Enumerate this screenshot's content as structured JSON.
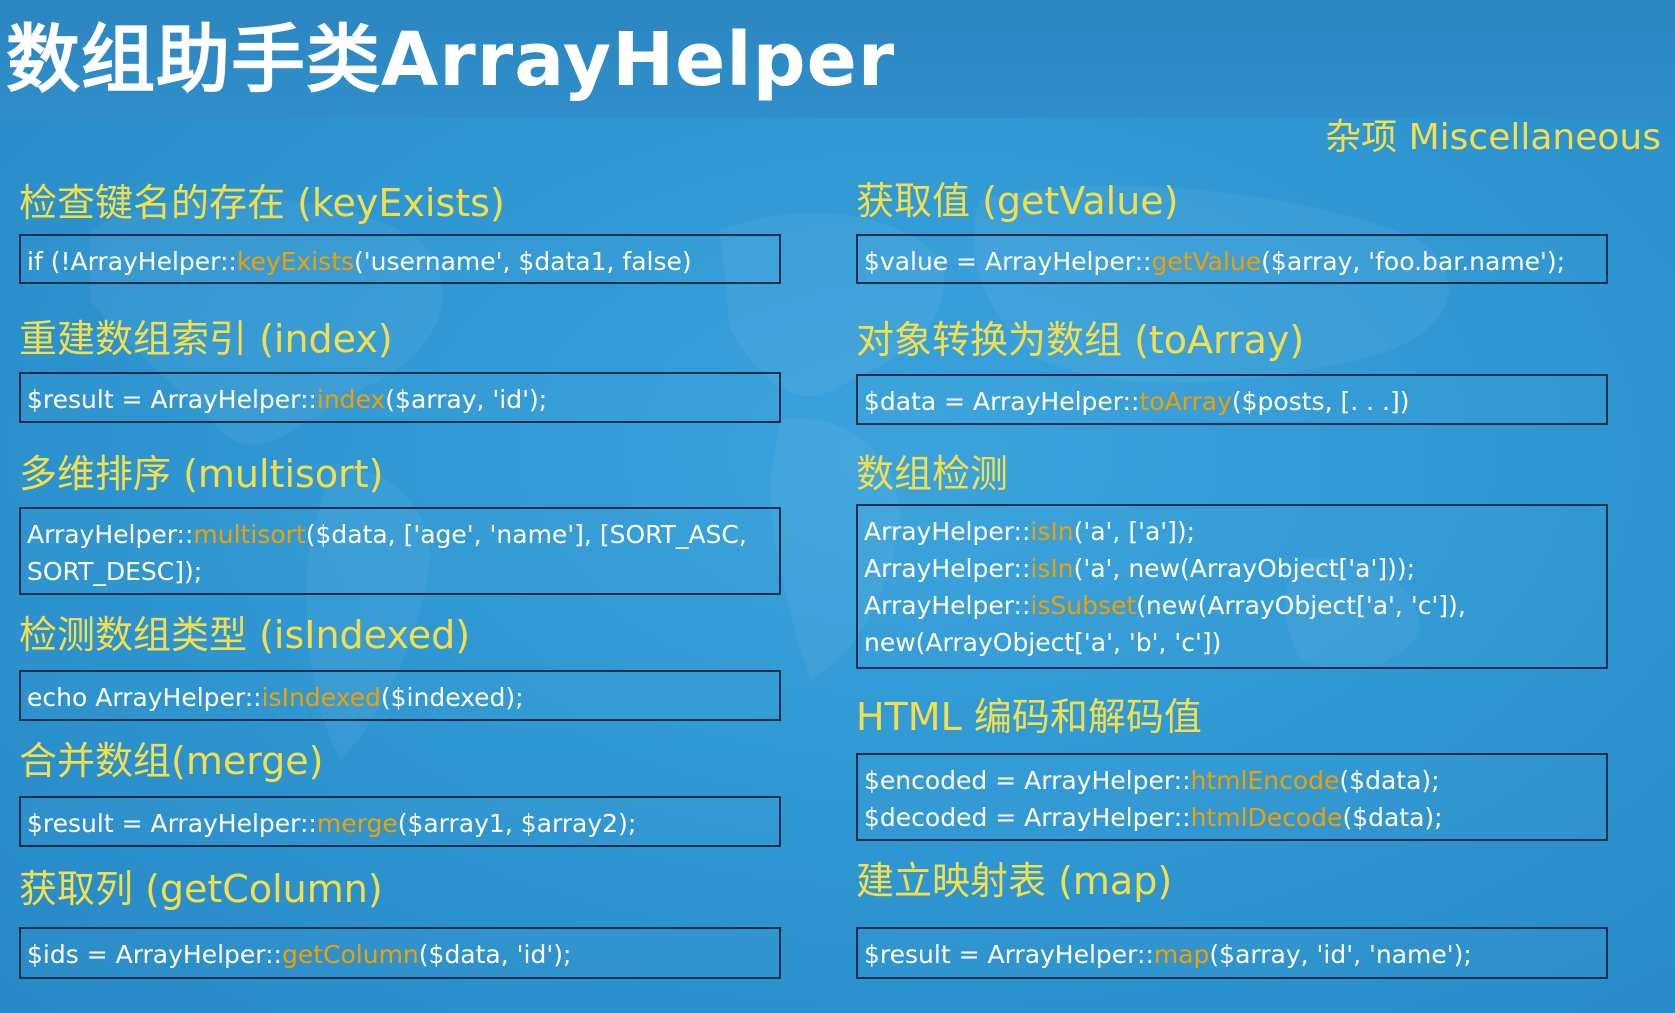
{
  "title": "数组助手类ArrayHelper",
  "subtitle": "杂项 Miscellaneous",
  "colors": {
    "heading": "#f3df4c",
    "method": "#f0a000",
    "code_text": "#ffffff",
    "background": "#2f98d3",
    "box_border": "#0e2f52"
  },
  "left": [
    {
      "heading": "检查键名的存在 (keyExists)",
      "lines": [
        {
          "before": "if (!ArrayHelper::",
          "method": "keyExists",
          "after": "('username', $data1, false)"
        }
      ]
    },
    {
      "heading": "重建数组索引 (index)",
      "lines": [
        {
          "before": "$result = ArrayHelper::",
          "method": "index",
          "after": "($array, 'id');"
        }
      ]
    },
    {
      "heading": "多维排序 (multisort)",
      "lines": [
        {
          "before": "ArrayHelper::",
          "method": "multisort",
          "after": "($data, ['age', 'name'], [SORT_ASC,"
        },
        {
          "before": "SORT_DESC]);",
          "method": "",
          "after": ""
        }
      ]
    },
    {
      "heading": "检测数组类型 (isIndexed)",
      "lines": [
        {
          "before": "echo ArrayHelper::",
          "method": "isIndexed",
          "after": "($indexed);"
        }
      ]
    },
    {
      "heading": "合并数组(merge)",
      "lines": [
        {
          "before": "$result = ArrayHelper::",
          "method": "merge",
          "after": "($array1, $array2);"
        }
      ]
    },
    {
      "heading": "获取列 (getColumn)",
      "lines": [
        {
          "before": "$ids = ArrayHelper::",
          "method": "getColumn",
          "after": "($data, 'id');"
        }
      ]
    }
  ],
  "right": [
    {
      "heading": "获取值 (getValue)",
      "lines": [
        {
          "before": "$value = ArrayHelper::",
          "method": "getValue",
          "after": "($array, 'foo.bar.name');"
        }
      ]
    },
    {
      "heading": "对象转换为数组 (toArray)",
      "lines": [
        {
          "before": "$data = ArrayHelper::",
          "method": "toArray",
          "after": "($posts, [. . .])"
        }
      ]
    },
    {
      "heading": "数组检测",
      "lines": [
        {
          "before": "ArrayHelper::",
          "method": "isIn",
          "after": "('a', ['a']);"
        },
        {
          "before": "ArrayHelper::",
          "method": "isIn",
          "after": "('a', new(ArrayObject['a']));"
        },
        {
          "before": "ArrayHelper::",
          "method": "isSubset",
          "after": "(new(ArrayObject['a', 'c']),"
        },
        {
          "before": "new(ArrayObject['a', 'b', 'c'])",
          "method": "",
          "after": ""
        }
      ]
    },
    {
      "heading": "HTML 编码和解码值",
      "lines": [
        {
          "before": "$encoded = ArrayHelper::",
          "method": "htmlEncode",
          "after": "($data);"
        },
        {
          "before": "$decoded = ArrayHelper::",
          "method": "htmlDecode",
          "after": "($data);"
        }
      ]
    },
    {
      "heading": "建立映射表 (map)",
      "lines": [
        {
          "before": "$result = ArrayHelper::",
          "method": "map",
          "after": "($array, 'id', 'name');"
        }
      ]
    }
  ]
}
